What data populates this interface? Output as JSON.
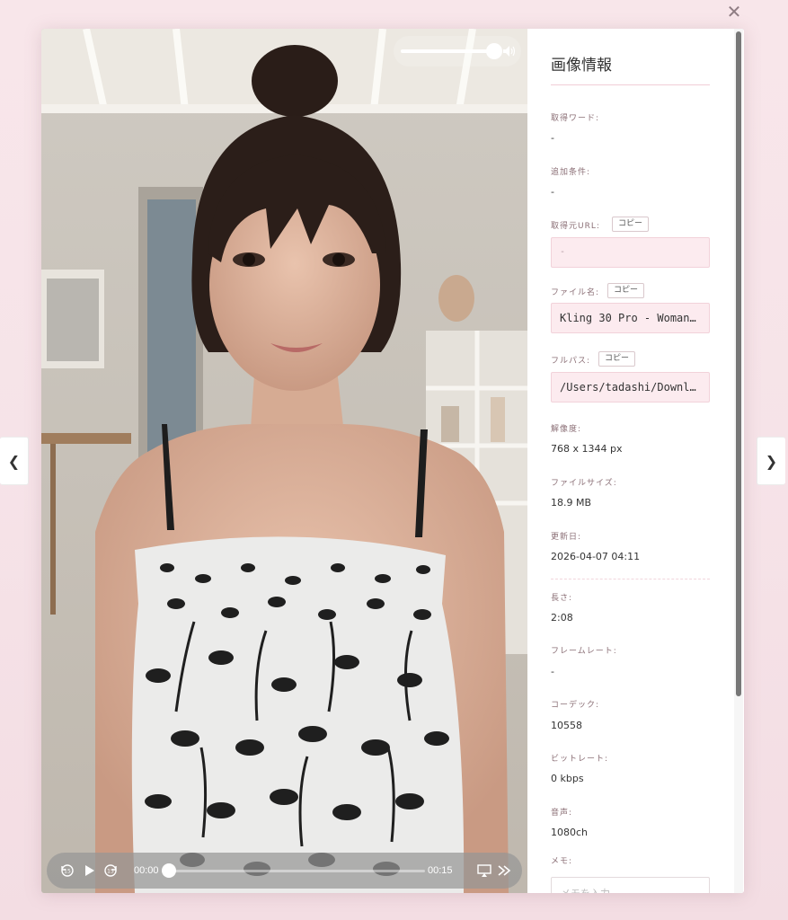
{
  "close_label": "✕",
  "nav": {
    "prev": "❮",
    "next": "❯"
  },
  "player": {
    "current_time": "00:00",
    "duration": "00:15",
    "progress": 0.0,
    "volume": 1.0,
    "icons": {
      "volume": "volume-high-icon",
      "rewind": "skip-back-15-icon",
      "play": "play-icon",
      "forward": "skip-forward-15-icon",
      "airplay": "airplay-icon",
      "speed": "fast-forward-icon"
    }
  },
  "info": {
    "title": "画像情報",
    "copy_label": "コピー",
    "fields": {
      "keyword": {
        "label": "取得ワード:",
        "value": "-"
      },
      "extra": {
        "label": "追加条件:",
        "value": "-"
      },
      "source_url": {
        "label": "取得元URL:",
        "value": "-"
      },
      "filename": {
        "label": "ファイル名:",
        "value": "Kling 30 Pro - Woman…"
      },
      "fullpath": {
        "label": "フルパス:",
        "value": "/Users/tadashi/Downloads/…"
      },
      "resolution": {
        "label": "解像度:",
        "value": "768 x 1344 px"
      },
      "filesize": {
        "label": "ファイルサイズ:",
        "value": "18.9 MB"
      },
      "updated": {
        "label": "更新日:",
        "value": "2026-04-07 04:11"
      },
      "length": {
        "label": "長さ:",
        "value": "2:08"
      },
      "framerate": {
        "label": "フレームレート:",
        "value": "-"
      },
      "codec": {
        "label": "コーデック:",
        "value": "10558"
      },
      "bitrate": {
        "label": "ビットレート:",
        "value": "0 kbps"
      },
      "audio": {
        "label": "音声:",
        "value": "1080ch"
      },
      "memo": {
        "label": "メモ:",
        "placeholder": "メモを入力"
      }
    }
  },
  "colors": {
    "page_bg": "#f6e3e8",
    "input_bg": "#fcebef",
    "label": "#8b6f76",
    "title_rule": "#f1cdd6"
  }
}
